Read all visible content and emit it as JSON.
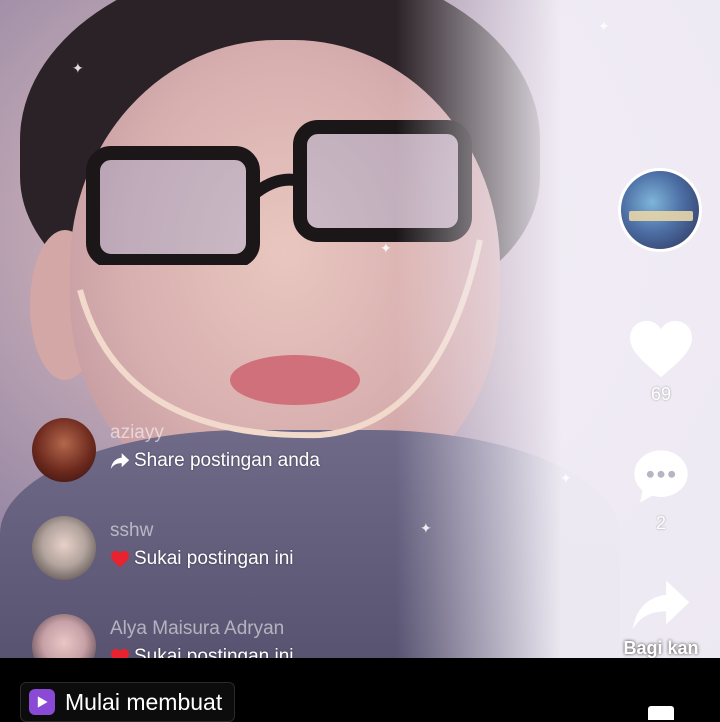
{
  "side": {
    "like_count": "69",
    "comment_count": "2",
    "share_label": "Bagi kan"
  },
  "activity": [
    {
      "username": "aziayy",
      "action": "Share postingan anda",
      "icon": "share-arrow-icon"
    },
    {
      "username": "sshw",
      "action": "Sukai postingan ini",
      "icon": "heart-icon"
    },
    {
      "username": "Alya Maisura Adryan",
      "action": "Sukai postingan ini",
      "icon": "heart-icon"
    }
  ],
  "bottom": {
    "start_label": "Mulai membuat",
    "start_icon": "play-square-icon"
  },
  "colors": {
    "heart_red": "#e8232f",
    "start_icon_purple": "#8a4ad6"
  }
}
